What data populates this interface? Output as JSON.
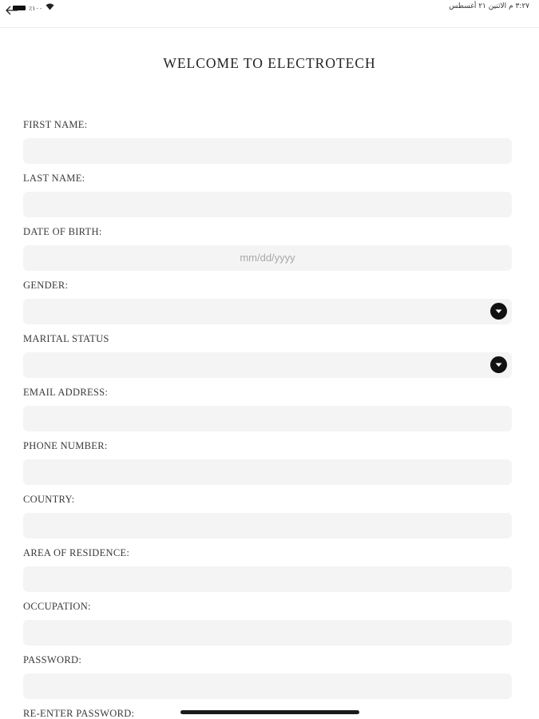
{
  "status_bar": {
    "battery_text": "٪١٠٠",
    "datetime": "٣:٢٧ م   الاثنين ٢١ أغسطس"
  },
  "title": "WELCOME TO ELECTROTECH",
  "form": {
    "first_name": {
      "label": "FIRST NAME:",
      "value": ""
    },
    "last_name": {
      "label": "LAST NAME:",
      "value": ""
    },
    "date_of_birth": {
      "label": "DATE OF BIRTH:",
      "placeholder": "mm/dd/yyyy"
    },
    "gender": {
      "label": "GENDER:",
      "value": ""
    },
    "marital_status": {
      "label": "MARITAL STATUS",
      "value": ""
    },
    "email": {
      "label": "EMAIL ADDRESS:",
      "value": ""
    },
    "phone": {
      "label": "PHONE NUMBER:",
      "value": ""
    },
    "country": {
      "label": "COUNTRY:",
      "value": ""
    },
    "area": {
      "label": "AREA OF RESIDENCE:",
      "value": ""
    },
    "occupation": {
      "label": "OCCUPATION:",
      "value": ""
    },
    "password": {
      "label": "PASSWORD:",
      "value": ""
    },
    "re_password": {
      "label": "RE-ENTER PASSWORD:"
    }
  },
  "icons": {
    "back": "back-arrow-icon",
    "dropdown": "chevron-down-icon",
    "battery": "battery-icon",
    "wifi": "wifi-icon"
  }
}
